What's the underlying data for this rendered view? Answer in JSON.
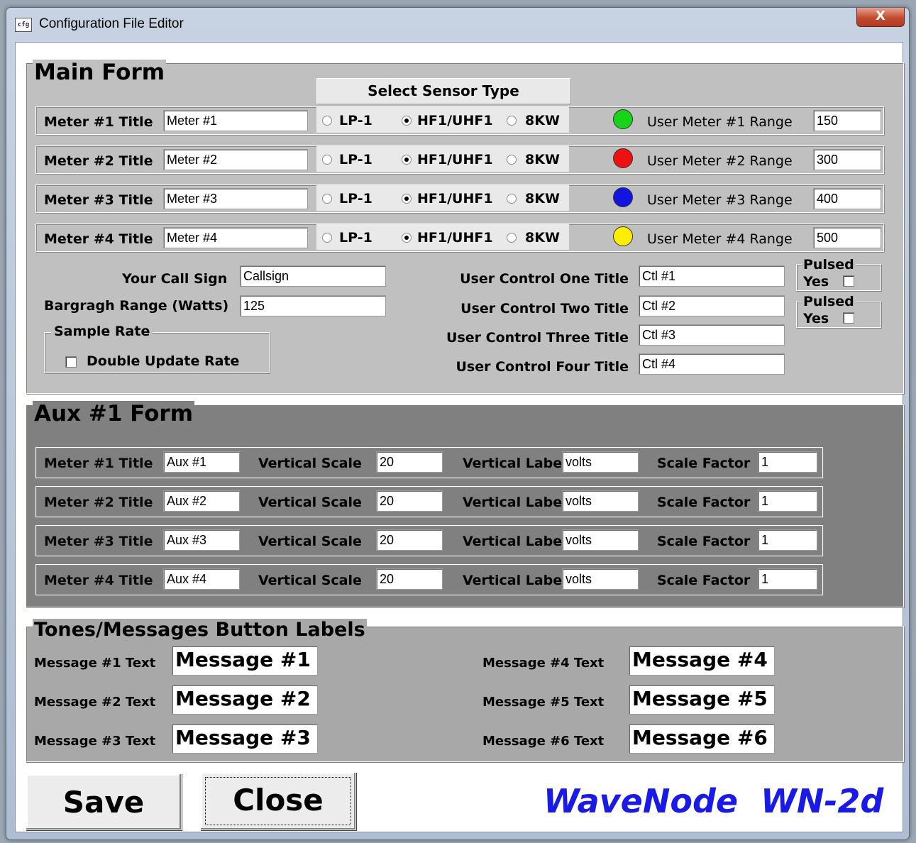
{
  "window": {
    "title": "Configuration File Editor",
    "close_glyph": "X",
    "icon_text": "cfg"
  },
  "main_form": {
    "legend": "Main Form",
    "sensor_header": "Select Sensor Type",
    "meters": [
      {
        "title_label": "Meter #1 Title",
        "title_value": "Meter #1",
        "options": [
          "LP-1",
          "HF1/UHF1",
          "8KW"
        ],
        "selected": "HF1/UHF1",
        "indicator_color": "#18d418",
        "range_label": "User Meter #1 Range",
        "range_value": "150"
      },
      {
        "title_label": "Meter #2 Title",
        "title_value": "Meter #2",
        "options": [
          "LP-1",
          "HF1/UHF1",
          "8KW"
        ],
        "selected": "HF1/UHF1",
        "indicator_color": "#ee1111",
        "range_label": "User Meter #2 Range",
        "range_value": "300"
      },
      {
        "title_label": "Meter #3 Title",
        "title_value": "Meter #3",
        "options": [
          "LP-1",
          "HF1/UHF1",
          "8KW"
        ],
        "selected": "HF1/UHF1",
        "indicator_color": "#1414e0",
        "range_label": "User Meter #3 Range",
        "range_value": "400"
      },
      {
        "title_label": "Meter #4 Title",
        "title_value": "Meter #4",
        "options": [
          "LP-1",
          "HF1/UHF1",
          "8KW"
        ],
        "selected": "HF1/UHF1",
        "indicator_color": "#ffee00",
        "range_label": "User Meter #4 Range",
        "range_value": "500"
      }
    ],
    "call_sign_label": "Your Call Sign",
    "call_sign_value": "Callsign",
    "bargraph_label": "Bargragh Range (Watts)",
    "bargraph_value": "125",
    "sample_rate_legend": "Sample Rate",
    "double_update_label": "Double Update Rate",
    "double_update_checked": false,
    "user_controls": [
      {
        "label": "User Control One Title",
        "value": "Ctl #1"
      },
      {
        "label": "User Control Two Title",
        "value": "Ctl #2"
      },
      {
        "label": "User Control Three Title",
        "value": "Ctl #3"
      },
      {
        "label": "User Control Four Title",
        "value": "Ctl #4"
      }
    ],
    "pulsed": [
      {
        "legend": "Pulsed",
        "label": "Yes",
        "checked": false
      },
      {
        "legend": "Pulsed",
        "label": "Yes",
        "checked": false
      }
    ]
  },
  "aux_form": {
    "legend": "Aux #1 Form",
    "rows": [
      {
        "title_label": "Meter #1 Title",
        "title_value": "Aux #1",
        "vscale_label": "Vertical Scale",
        "vscale_value": "20",
        "vlabel_label": "Vertical Label",
        "vlabel_value": "volts",
        "sf_label": "Scale Factor",
        "sf_value": "1"
      },
      {
        "title_label": "Meter #2 Title",
        "title_value": "Aux #2",
        "vscale_label": "Vertical Scale",
        "vscale_value": "20",
        "vlabel_label": "Vertical Label",
        "vlabel_value": "volts",
        "sf_label": "Scale Factor",
        "sf_value": "1"
      },
      {
        "title_label": "Meter #3 Title",
        "title_value": "Aux #3",
        "vscale_label": "Vertical Scale",
        "vscale_value": "20",
        "vlabel_label": "Vertical Label",
        "vlabel_value": "volts",
        "sf_label": "Scale Factor",
        "sf_value": "1"
      },
      {
        "title_label": "Meter #4 Title",
        "title_value": "Aux #4",
        "vscale_label": "Vertical Scale",
        "vscale_value": "20",
        "vlabel_label": "Vertical Label",
        "vlabel_value": "volts",
        "sf_label": "Scale Factor",
        "sf_value": "1"
      }
    ]
  },
  "tones": {
    "legend": "Tones/Messages Button Labels",
    "messages": [
      {
        "label": "Message #1 Text",
        "value": "Message #1"
      },
      {
        "label": "Message #2 Text",
        "value": "Message #2"
      },
      {
        "label": "Message #3 Text",
        "value": "Message #3"
      },
      {
        "label": "Message #4 Text",
        "value": "Message #4"
      },
      {
        "label": "Message #5 Text",
        "value": "Message #5"
      },
      {
        "label": "Message #6 Text",
        "value": "Message #6"
      }
    ]
  },
  "footer": {
    "save_label": "Save",
    "close_label": "Close",
    "brand": "WaveNode  WN-2d"
  },
  "colors": {
    "main_bg": "#c0c0c0",
    "aux_bg": "#808080",
    "tones_bg": "#a8a8a8",
    "brand": "#1a1ae6"
  }
}
